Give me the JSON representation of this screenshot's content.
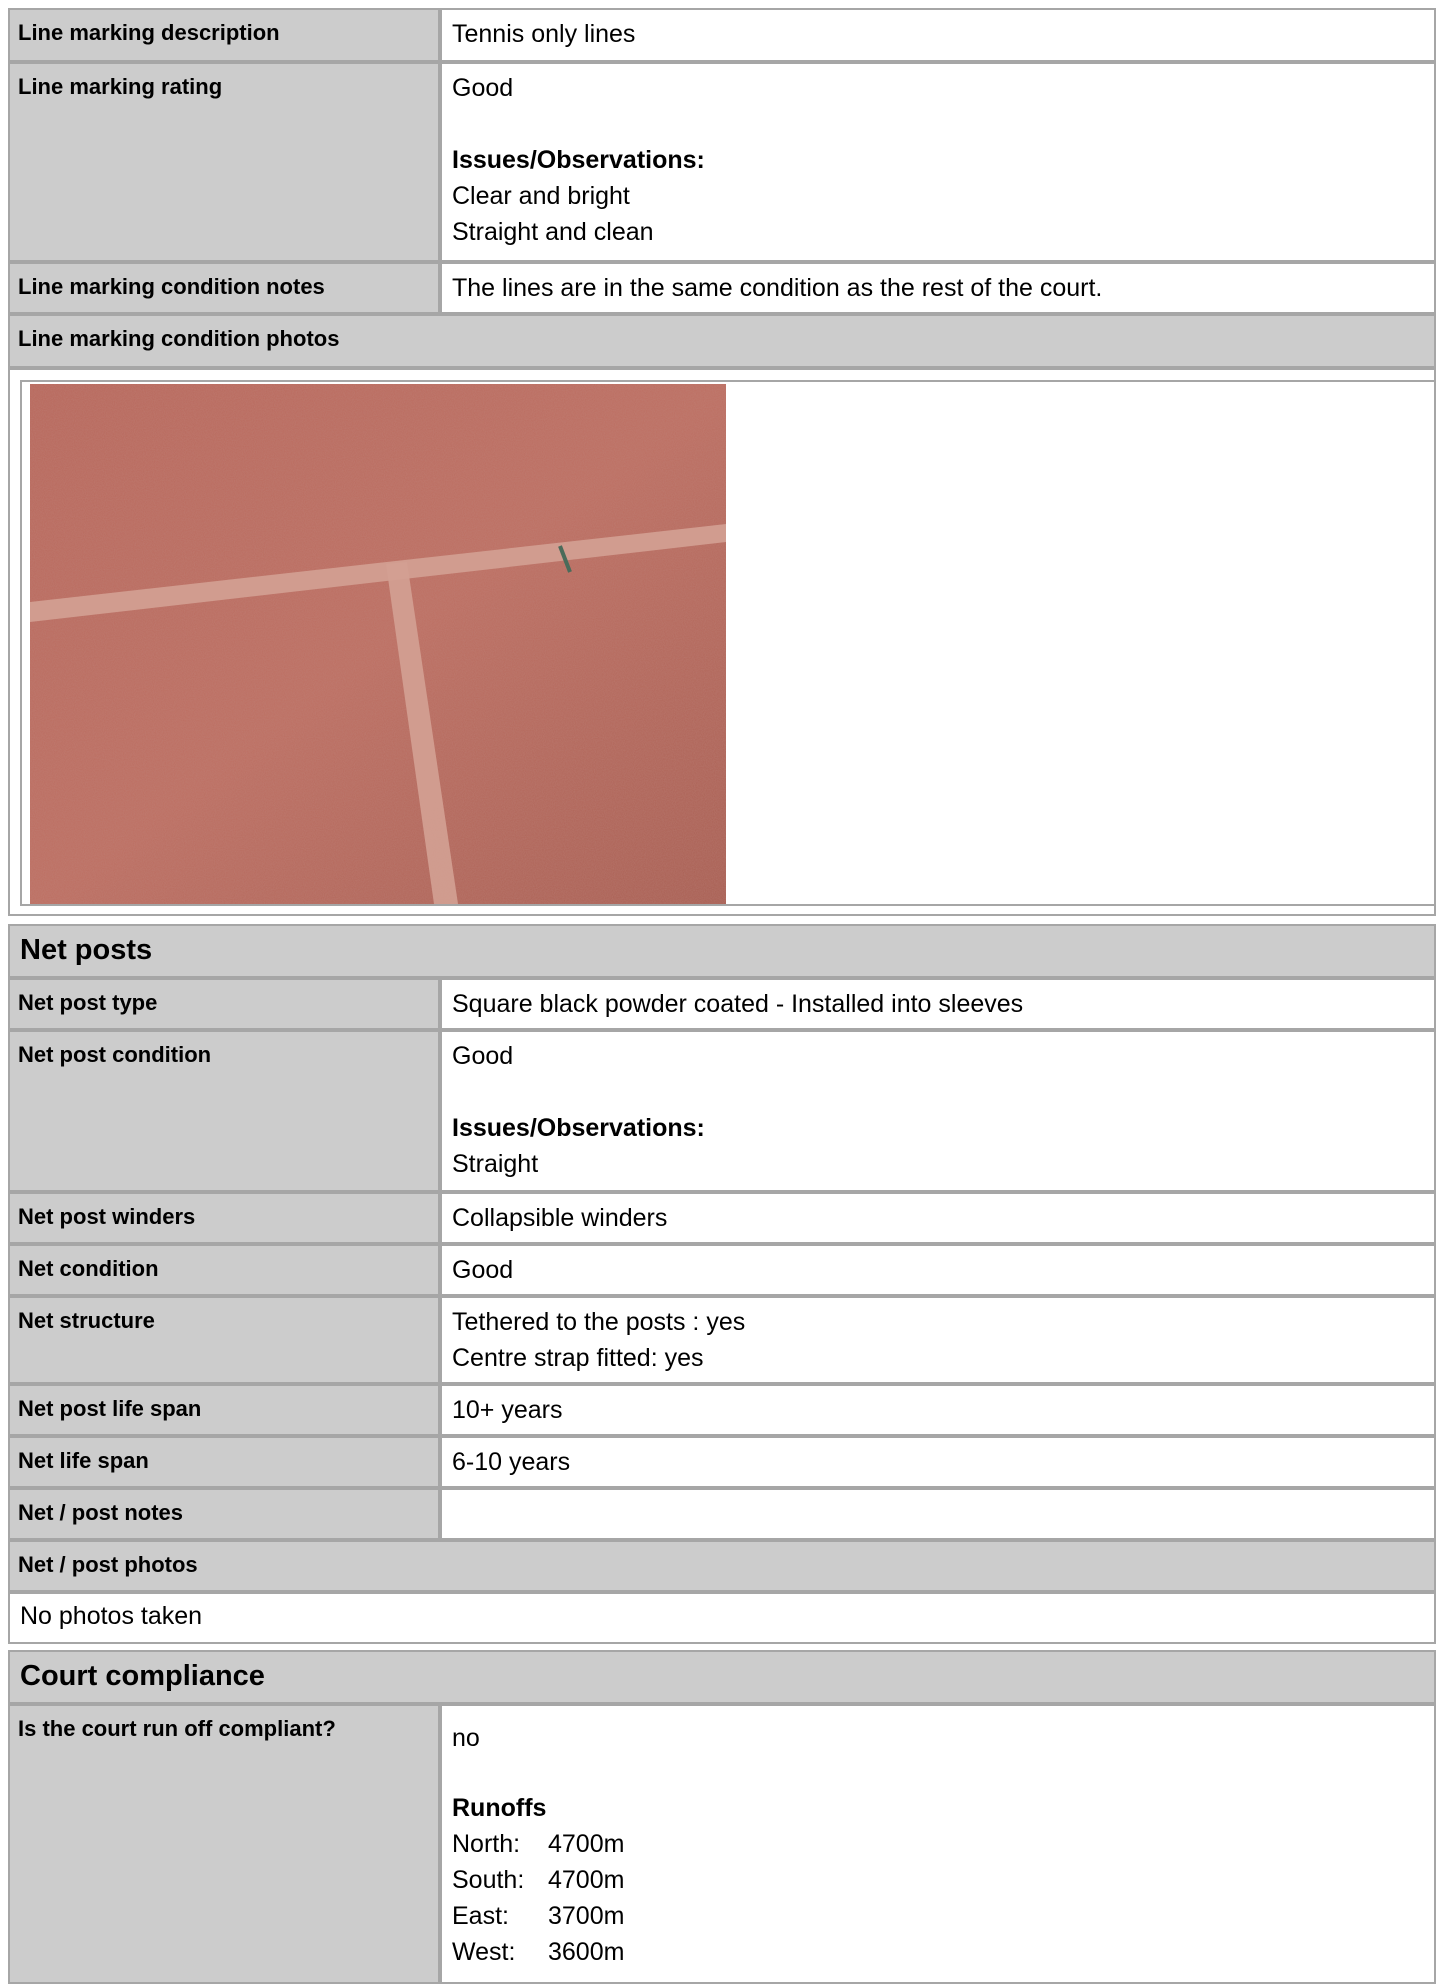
{
  "line_marking": {
    "description_label": "Line marking description",
    "description_value": "Tennis only lines",
    "rating_label": "Line marking rating",
    "rating_value": "Good",
    "rating_obs_title": "Issues/Observations:",
    "rating_obs_1": "Clear and bright",
    "rating_obs_2": "Straight and clean",
    "notes_label": "Line marking condition notes",
    "notes_value": "The lines are in the same condition as the rest of the court.",
    "photos_label": "Line marking condition photos"
  },
  "net_posts": {
    "section_title": "Net posts",
    "type_label": "Net post type",
    "type_value": "Square black powder coated - Installed into sleeves",
    "condition_label": "Net post condition",
    "condition_value": "Good",
    "condition_obs_title": "Issues/Observations:",
    "condition_obs_1": "Straight",
    "winders_label": "Net post winders",
    "winders_value": "Collapsible winders",
    "net_condition_label": "Net condition",
    "net_condition_value": "Good",
    "structure_label": "Net structure",
    "structure_value_1": "Tethered to the posts : yes",
    "structure_value_2": "Centre strap fitted: yes",
    "post_life_label": "Net post life span",
    "post_life_value": "10+ years",
    "net_life_label": "Net life span",
    "net_life_value": "6-10 years",
    "notes_label": "Net / post notes",
    "notes_value": "",
    "photos_label": "Net / post photos",
    "photos_value": "No photos taken"
  },
  "compliance": {
    "section_title": "Court compliance",
    "runoff_label": "Is the court run off compliant?",
    "runoff_value": "no",
    "runoffs_title": "Runoffs",
    "runoffs": [
      {
        "dir": "North:",
        "value": "4700m"
      },
      {
        "dir": "South:",
        "value": "4700m"
      },
      {
        "dir": "East:",
        "value": "3700m"
      },
      {
        "dir": "West:",
        "value": "3600m"
      }
    ]
  },
  "colors": {
    "label_bg": "#cccccc",
    "border": "#a6a6a6",
    "court_surface": "#b5665a",
    "court_line": "#d9a598"
  }
}
